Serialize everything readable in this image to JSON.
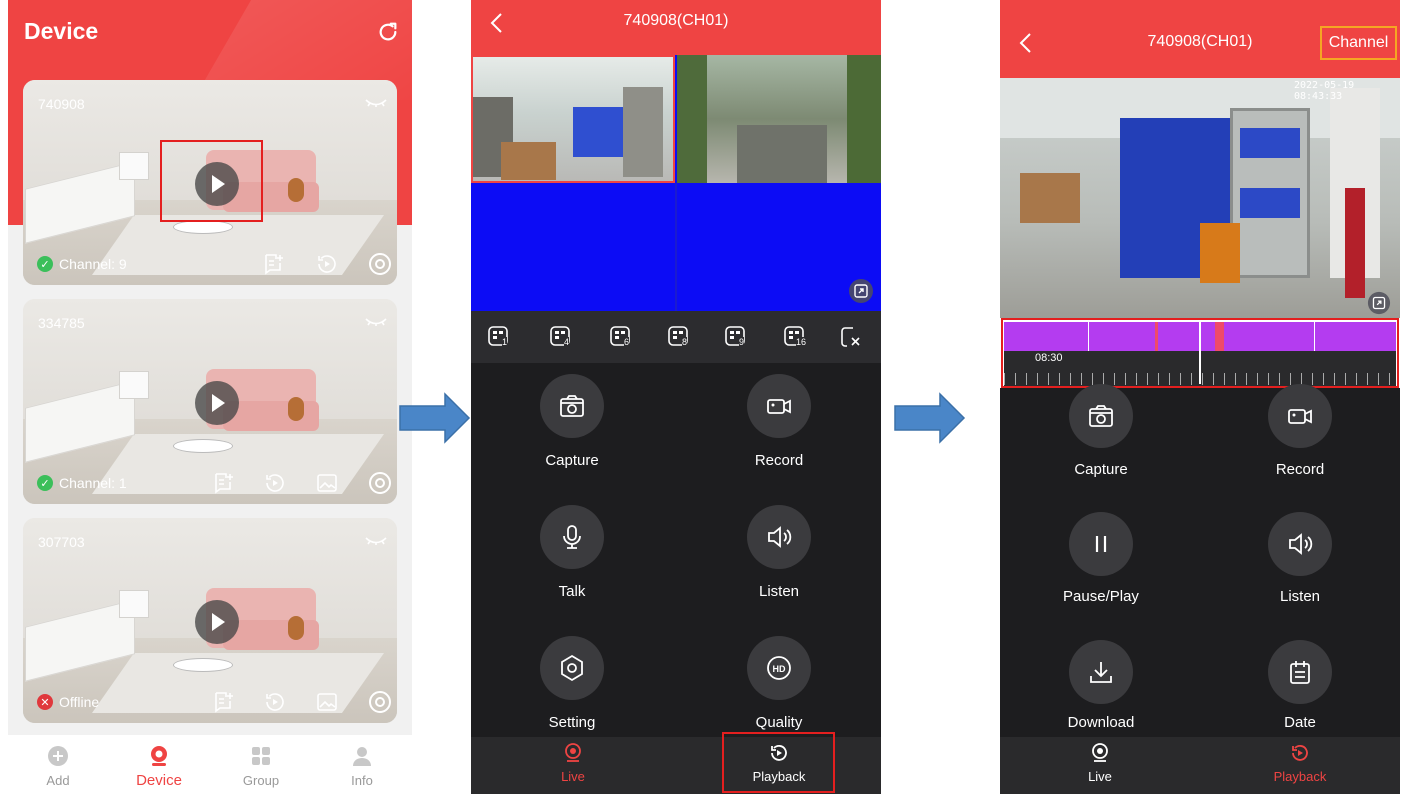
{
  "screen1": {
    "title": "Device",
    "devices": [
      {
        "name": "740908",
        "status": "Channel: 9",
        "status_type": "online"
      },
      {
        "name": "334785",
        "status": "Channel: 1",
        "status_type": "online"
      },
      {
        "name": "307703",
        "status": "Offline",
        "status_type": "offline"
      }
    ],
    "tabs": [
      {
        "label": "Add",
        "icon": "plus-circle-icon"
      },
      {
        "label": "Device",
        "icon": "camera-icon",
        "active": true
      },
      {
        "label": "Group",
        "icon": "grid-icon"
      },
      {
        "label": "Info",
        "icon": "user-icon"
      }
    ]
  },
  "screen2": {
    "title": "740908(CH01)",
    "layout_icons": [
      "1",
      "4",
      "6",
      "8",
      "9",
      "16"
    ],
    "functions": [
      {
        "label": "Capture",
        "icon": "capture-icon"
      },
      {
        "label": "Record",
        "icon": "record-icon"
      },
      {
        "label": "Talk",
        "icon": "microphone-icon"
      },
      {
        "label": "Listen",
        "icon": "speaker-icon"
      },
      {
        "label": "Setting",
        "icon": "setting-icon"
      },
      {
        "label": "Quality",
        "icon": "hd-icon"
      }
    ],
    "tabs": [
      {
        "label": "Live",
        "active": true
      },
      {
        "label": "Playback"
      }
    ]
  },
  "screen3": {
    "title": "740908(CH01)",
    "channel_button": "Channel",
    "timestamp": "2022-05-19 08:43:33",
    "timeline_label": "08:30",
    "functions": [
      {
        "label": "Capture",
        "icon": "capture-icon"
      },
      {
        "label": "Record",
        "icon": "record-icon"
      },
      {
        "label": "Pause/Play",
        "icon": "pause-icon"
      },
      {
        "label": "Listen",
        "icon": "speaker-icon"
      },
      {
        "label": "Download",
        "icon": "download-icon"
      },
      {
        "label": "Date",
        "icon": "calendar-icon"
      }
    ],
    "tabs": [
      {
        "label": "Live"
      },
      {
        "label": "Playback",
        "active": true
      }
    ]
  },
  "colors": {
    "accent": "#ef4443",
    "timeline": "#b43cf0",
    "highlight_red": "#e41f1f",
    "highlight_orange": "#f5a623",
    "arrow": "#4a86c8"
  }
}
